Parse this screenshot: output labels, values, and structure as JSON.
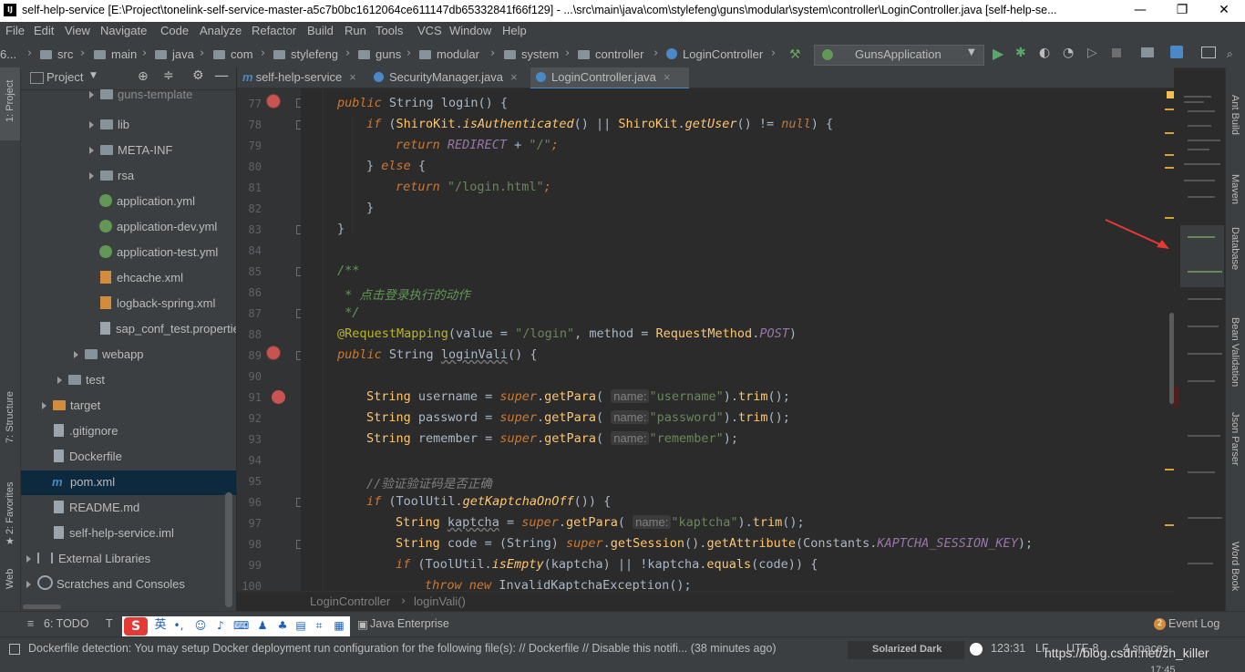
{
  "title_bar": {
    "title": "self-help-service [E:\\Project\\tonelink-self-service-master-a5c7b0bc1612064ce611147db65332841f66f129] - ...\\src\\main\\java\\com\\stylefeng\\guns\\modular\\system\\controller\\LoginController.java [self-help-se...",
    "app_icon": "IJ",
    "minimize": "—",
    "maximize": "❐",
    "close": "✕"
  },
  "menu": [
    "File",
    "Edit",
    "View",
    "Navigate",
    "Code",
    "Analyze",
    "Refactor",
    "Build",
    "Run",
    "Tools",
    "VCS",
    "Window",
    "Help"
  ],
  "breadcrumbs": {
    "lead": "6...",
    "items": [
      "src",
      "main",
      "java",
      "com",
      "stylefeng",
      "guns",
      "modular",
      "system",
      "controller",
      "LoginController"
    ],
    "run_config": "GunsApplication"
  },
  "left_strip": {
    "project": "1: Project",
    "structure": "7: Structure",
    "favorites": "2: Favorites",
    "web": "Web"
  },
  "project_panel": {
    "header": "Project",
    "items": [
      {
        "label": "guns-template",
        "kind": "folder"
      },
      {
        "label": "lib",
        "kind": "folder"
      },
      {
        "label": "META-INF",
        "kind": "folder"
      },
      {
        "label": "rsa",
        "kind": "folder"
      },
      {
        "label": "application.yml",
        "kind": "yml"
      },
      {
        "label": "application-dev.yml",
        "kind": "yml"
      },
      {
        "label": "application-test.yml",
        "kind": "yml"
      },
      {
        "label": "ehcache.xml",
        "kind": "xml"
      },
      {
        "label": "logback-spring.xml",
        "kind": "xml"
      },
      {
        "label": "sap_conf_test.properties",
        "kind": "file"
      },
      {
        "label": "webapp",
        "kind": "folder"
      },
      {
        "label": "test",
        "kind": "folder"
      },
      {
        "label": "target",
        "kind": "folder-orange"
      },
      {
        "label": ".gitignore",
        "kind": "file"
      },
      {
        "label": "Dockerfile",
        "kind": "file"
      },
      {
        "label": "pom.xml",
        "kind": "maven"
      },
      {
        "label": "README.md",
        "kind": "file"
      },
      {
        "label": "self-help-service.iml",
        "kind": "file"
      },
      {
        "label": "External Libraries",
        "kind": "lib"
      },
      {
        "label": "Scratches and Consoles",
        "kind": "scratch"
      }
    ]
  },
  "tabs": [
    "self-help-service",
    "SecurityManager.java",
    "LoginController.java"
  ],
  "editor": {
    "line_numbers": [
      "77",
      "78",
      "79",
      "80",
      "81",
      "82",
      "83",
      "84",
      "85",
      "86",
      "87",
      "88",
      "89",
      "90",
      "91",
      "92",
      "93",
      "94",
      "95",
      "96",
      "97",
      "98",
      "99",
      "100"
    ],
    "hint_name": "name:",
    "l77": {
      "kw1": "public",
      "type": "String",
      "name": "login",
      "rest": "() {"
    },
    "l78": {
      "kw": "if",
      "a": "(",
      "cls1": "ShiroKit",
      "m1": "isAuthenticated",
      "b": "() || ",
      "cls2": "ShiroKit",
      "m2": "getUser",
      "c": "() != ",
      "null": "null",
      "d": ") {"
    },
    "l79": {
      "kw": "return",
      "const": "REDIRECT",
      "op": " + ",
      "str": "\"/\"",
      "end": ";"
    },
    "l80": {
      "a": "} ",
      "kw": "else",
      "b": " {"
    },
    "l81": {
      "kw": "return",
      "str": "\"/login.html\"",
      "end": ";"
    },
    "l82": "}",
    "l83": "}",
    "l85": "/**",
    "l86": " * 点击登录执行的动作",
    "l87": " */",
    "l88": {
      "ann": "@RequestMapping",
      "a": "(value = ",
      "s1": "\"/login\"",
      "b": ", method = ",
      "cls": "RequestMethod",
      "dot": ".",
      "c": "POST",
      "d": ")"
    },
    "l89": {
      "kw1": "public",
      "type": "String",
      "name": "loginVali",
      "rest": "() {"
    },
    "l91": {
      "type": "String",
      "var": "username",
      "eq": " = ",
      "sup": "super",
      "m": "getPara",
      "str": "\"username\"",
      "tail": ").",
      "trim": "trim",
      "end": "();"
    },
    "l92": {
      "type": "String",
      "var": "password",
      "eq": " = ",
      "sup": "super",
      "m": "getPara",
      "str": "\"password\"",
      "tail": ").",
      "trim": "trim",
      "end": "();"
    },
    "l93": {
      "type": "String",
      "var": "remember",
      "eq": " = ",
      "sup": "super",
      "m": "getPara",
      "str": "\"remember\"",
      "end": ");"
    },
    "l95": "//验证验证码是否正确",
    "l96": {
      "kw": "if",
      "a": " (ToolUtil.",
      "m": "getKaptchaOnOff",
      "b": "()) {"
    },
    "l97": {
      "type": "String",
      "var": "kaptcha",
      "eq": " = ",
      "sup": "super",
      "m": "getPara",
      "str": "\"kaptcha\"",
      "tail": ").",
      "trim": "trim",
      "end": "();"
    },
    "l98": {
      "type": "String",
      "var": "code",
      "a": " = (String) ",
      "sup": "super",
      "m1": "getSession",
      "b": "().",
      "m2": "getAttribute",
      "c": "(Constants.",
      "const": "KAPTCHA_SESSION_KEY",
      "d": ");"
    },
    "l99": {
      "kw": "if",
      "a": " (ToolUtil.",
      "m": "isEmpty",
      "b": "(kaptcha) || !kaptcha.",
      "m2": "equals",
      "c": "(code)) {"
    },
    "l100": {
      "kw1": "throw",
      "kw2": "new",
      "cls": "InvalidKaptchaException",
      "end": "();"
    }
  },
  "editor_breadcrumbs": [
    "LoginController",
    "loginVali()"
  ],
  "right_strip": [
    "Ant Build",
    "Maven",
    "Database",
    "Bean Validation",
    "Json Parser",
    "Word Book"
  ],
  "tool_windows": {
    "todo": "6: TODO",
    "terminal": "T",
    "java_enterprise": "Java Enterprise",
    "event_log": "Event Log",
    "event_count": "2"
  },
  "ime": {
    "lang": "英",
    "punct": "•,"
  },
  "status": {
    "message": "Dockerfile detection: You may setup Docker deployment run configuration for the following file(s): // Dockerfile // Disable this notifi... (38 minutes ago)",
    "theme": "Solarized Dark",
    "position": "123:31",
    "line_sep": "LF",
    "encoding": "UTF-8",
    "indent": "4 spaces",
    "watermark": "https://blog.csdn.net/zh_killer",
    "clock": "17:45"
  },
  "colors": {
    "keyword": "#cc7832",
    "string": "#6a8759",
    "annotation": "#bbb529",
    "comment": "#629755",
    "breakpoint": "#c75450",
    "accent": "#4a88c7"
  }
}
